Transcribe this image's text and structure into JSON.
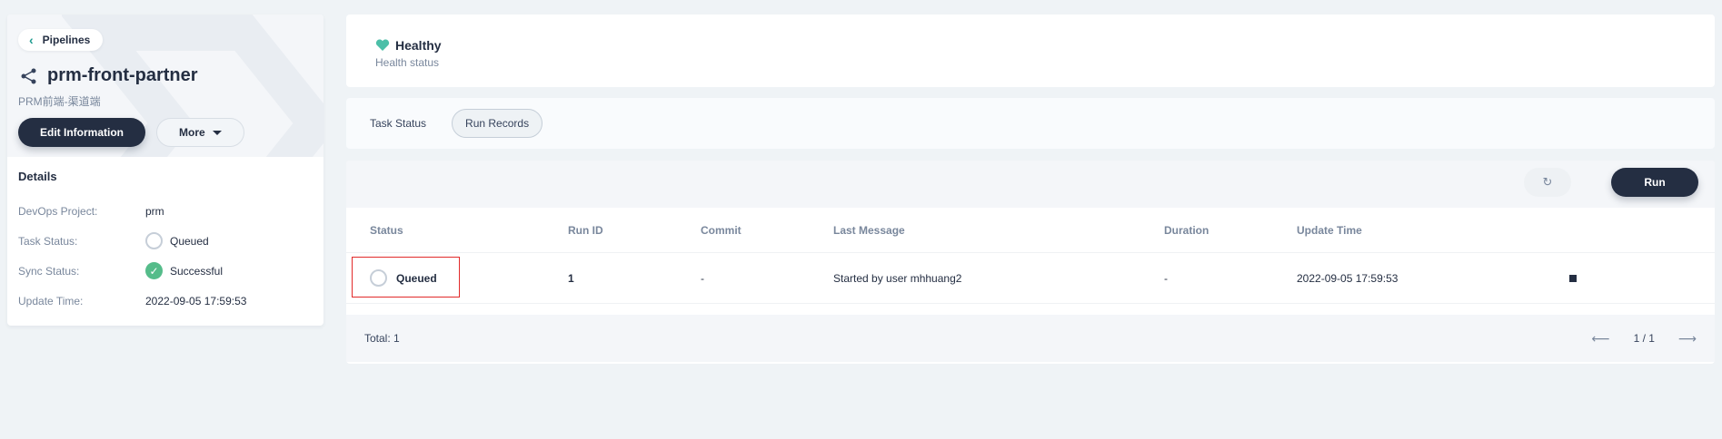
{
  "left": {
    "back_label": "Pipelines",
    "pipeline_name": "prm-front-partner",
    "description": "PRM前端-渠道端",
    "edit_button": "Edit Information",
    "more_button": "More",
    "details_title": "Details",
    "details": [
      {
        "key": "DevOps Project:",
        "value": "prm"
      },
      {
        "key": "Task Status:",
        "value": "Queued"
      },
      {
        "key": "Sync Status:",
        "value": "Successful"
      },
      {
        "key": "Update Time:",
        "value": "2022-09-05 17:59:53"
      }
    ]
  },
  "health": {
    "title": "Healthy",
    "subtitle": "Health status"
  },
  "tabs": [
    {
      "label": "Task Status",
      "active": false
    },
    {
      "label": "Run Records",
      "active": true
    }
  ],
  "toolbar": {
    "run_label": "Run",
    "refresh_icon": "refresh-icon"
  },
  "table": {
    "headers": [
      "Status",
      "Run ID",
      "Commit",
      "Last Message",
      "Duration",
      "Update Time"
    ],
    "rows": [
      {
        "status": "Queued",
        "run_id": "1",
        "commit": "-",
        "last_message": "Started by user mhhuang2",
        "duration": "-",
        "update_time": "2022-09-05 17:59:53"
      }
    ]
  },
  "footer": {
    "total": "Total: 1",
    "page": "1 / 1"
  },
  "colors": {
    "accent": "#242e42",
    "success": "#55bc8a",
    "healthy": "#4cbfa8",
    "highlight": "#e22a2a"
  }
}
